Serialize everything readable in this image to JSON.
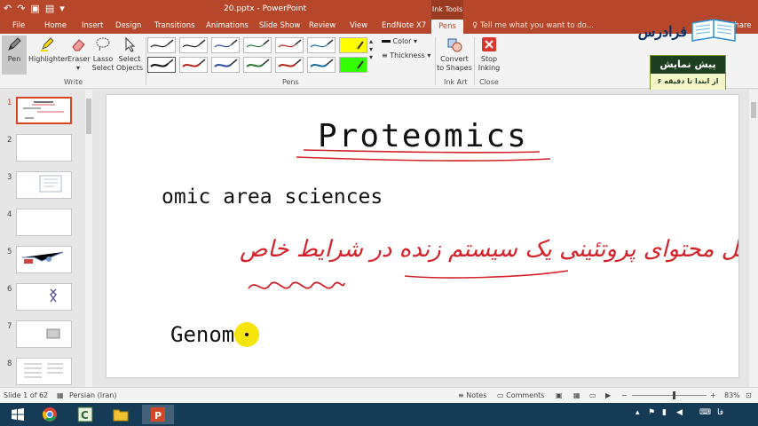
{
  "window": {
    "document_title": "20.pptx - PowerPoint",
    "context_tab_group": "Ink Tools"
  },
  "tabs": [
    "File",
    "Home",
    "Insert",
    "Design",
    "Transitions",
    "Animations",
    "Slide Show",
    "Review",
    "View",
    "EndNote X7"
  ],
  "active_tab": "Pens",
  "tell_me": "Tell me what you want to do...",
  "share": "Share",
  "ribbon": {
    "write": {
      "label": "Write",
      "pen": "Pen",
      "highlighter": "Highlighter",
      "eraser": "Eraser",
      "lasso_1": "Lasso",
      "lasso_2": "Select",
      "select_1": "Select",
      "select_2": "Objects"
    },
    "pens": {
      "label": "Pens",
      "color": "Color",
      "thickness": "Thickness"
    },
    "ink_art": {
      "label": "Ink Art",
      "convert_1": "Convert",
      "convert_2": "to Shapes"
    },
    "close": {
      "label": "Close",
      "stop_1": "Stop",
      "stop_2": "Inking"
    },
    "pen_colors": [
      "#1a1a1a",
      "#1a1a1a",
      "#2e4f9a",
      "#2b7a3d",
      "#b1291f",
      "#1b6a9a",
      "#ffff00",
      "#00e5ff",
      "#111111",
      "#b1291f",
      "#2e4f9a",
      "#2b7a3d",
      "#b1291f",
      "#1b6a9a",
      "#33ff00",
      "#ff00ff"
    ]
  },
  "brand": {
    "wordmark": "فرادرس",
    "ad_title": "پیش نمایش",
    "ad_subtitle": "از ابتدا تا دقیقه ۶"
  },
  "thumbnails": [
    {
      "num": "1"
    },
    {
      "num": "2"
    },
    {
      "num": "3"
    },
    {
      "num": "4"
    },
    {
      "num": "5"
    },
    {
      "num": "6"
    },
    {
      "num": "7"
    },
    {
      "num": "8"
    }
  ],
  "slide": {
    "title": "Proteomics",
    "line_en": "omic  area  sciences",
    "line_fa": "کل محتوای پروتئینی یک سیستم زنده در شرایط خاص",
    "line_bottom": "Genom"
  },
  "status": {
    "slide_counter": "Slide 1 of 62",
    "language": "Persian (Iran)",
    "notes": "Notes",
    "comments": "Comments",
    "zoom": "83%"
  },
  "taskbar": {
    "lang": "فا"
  },
  "colors": {
    "accent": "#b7472a",
    "ink_red": "#d2232a",
    "ink_black": "#111111",
    "pointer": "#f5e400"
  }
}
